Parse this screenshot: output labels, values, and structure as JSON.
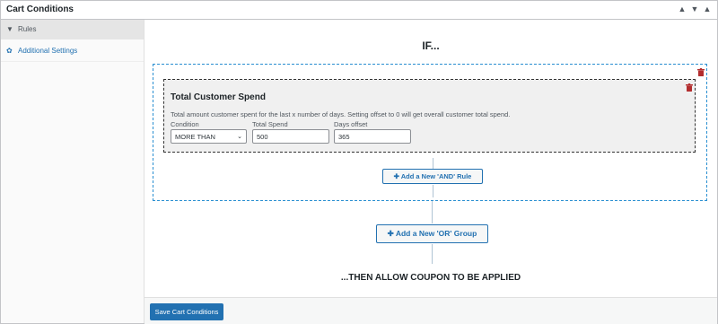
{
  "panel": {
    "title": "Cart Conditions",
    "controls": {
      "up": "▲",
      "down": "▼",
      "collapse": "▲"
    }
  },
  "sidebar": {
    "items": [
      {
        "label": "Rules",
        "icon": "filter-icon",
        "glyph": "▼",
        "active": true
      },
      {
        "label": "Additional Settings",
        "icon": "gear-icon",
        "glyph": "✿",
        "active": false
      }
    ]
  },
  "main": {
    "if_title": "IF...",
    "then_title": "...THEN ALLOW COUPON TO BE APPLIED",
    "group": {
      "rule": {
        "title": "Total Customer Spend",
        "description": "Total amount customer spent for the last x number of days. Setting offset to 0 will get overall customer total spend.",
        "fields": {
          "condition_label": "Condition",
          "condition_value": "MORE THAN",
          "spend_label": "Total Spend",
          "spend_value": "500",
          "days_label": "Days offset",
          "days_value": "365"
        }
      },
      "add_and_label": "Add a New 'AND' Rule"
    },
    "add_or_label": "Add a New 'OR' Group"
  },
  "footer": {
    "save_label": "Save Cart Conditions"
  },
  "colors": {
    "accent": "#2271b1",
    "danger": "#b32d2e",
    "dashed_border": "#2a8fd1"
  }
}
